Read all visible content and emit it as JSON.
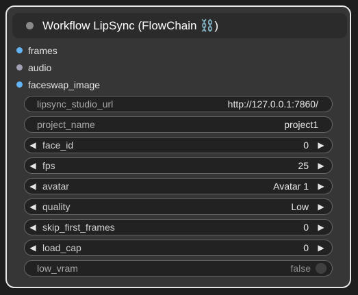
{
  "node": {
    "title": "Workflow LipSync (FlowChain ⛓️)",
    "inputs": [
      {
        "label": "frames",
        "color": "#64b5f6"
      },
      {
        "label": "audio",
        "color": "#a0a0b4"
      },
      {
        "label": "faceswap_image",
        "color": "#64b5f6"
      }
    ],
    "widgets": {
      "lipsync_studio_url": {
        "label": "lipsync_studio_url",
        "value": "http://127.0.0.1:7860/"
      },
      "project_name": {
        "label": "project_name",
        "value": "project1"
      },
      "face_id": {
        "label": "face_id",
        "value": "0"
      },
      "fps": {
        "label": "fps",
        "value": "25"
      },
      "avatar": {
        "label": "avatar",
        "value": "Avatar 1"
      },
      "quality": {
        "label": "quality",
        "value": "Low"
      },
      "skip_first_frames": {
        "label": "skip_first_frames",
        "value": "0"
      },
      "load_cap": {
        "label": "load_cap",
        "value": "0"
      },
      "low_vram": {
        "label": "low_vram",
        "value": "false"
      }
    },
    "arrows": {
      "left": "◀",
      "right": "▶"
    }
  }
}
